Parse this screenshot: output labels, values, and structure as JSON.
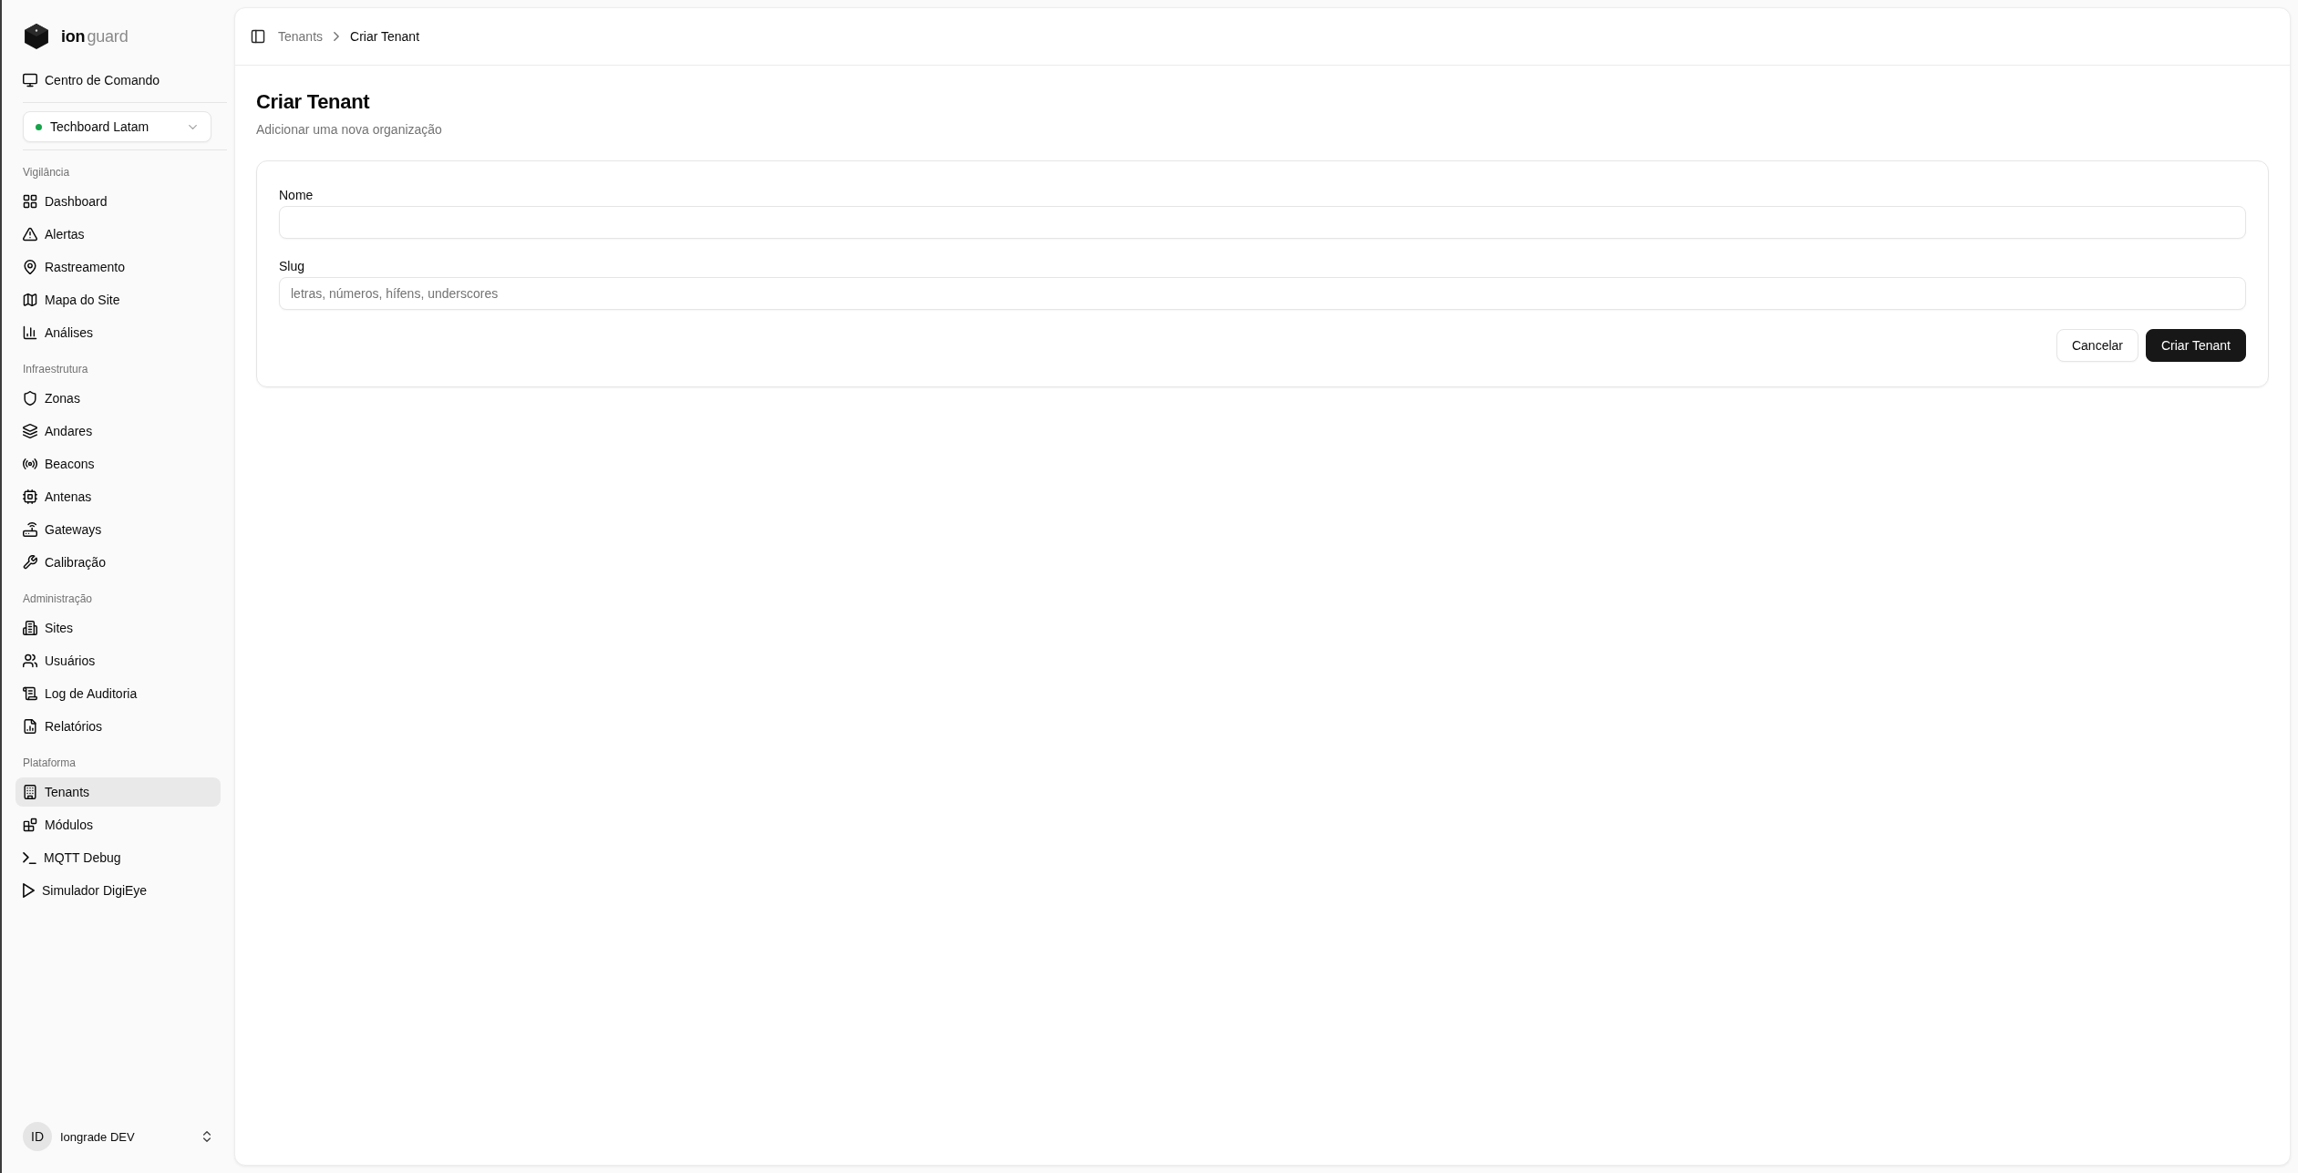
{
  "sidebar": {
    "brand": "**ion**guard",
    "command_center": {
      "label": "Centro de Comando"
    },
    "tenant_select": {
      "value": "Techboard Latam"
    },
    "sections": [
      {
        "title": "Vigilância",
        "items": [
          {
            "label": "Dashboard",
            "selected": false
          },
          {
            "label": "Alertas",
            "selected": false
          },
          {
            "label": "Rastreamento",
            "selected": false
          },
          {
            "label": "Mapa do Site",
            "selected": false
          },
          {
            "label": "Análises",
            "selected": false
          }
        ]
      },
      {
        "title": "Infraestrutura",
        "items": [
          {
            "label": "Zonas",
            "selected": false
          },
          {
            "label": "Andares",
            "selected": false
          },
          {
            "label": "Beacons",
            "selected": false
          },
          {
            "label": "Antenas",
            "selected": false
          },
          {
            "label": "Gateways",
            "selected": false
          },
          {
            "label": "Calibração",
            "selected": false
          }
        ]
      },
      {
        "title": "Administração",
        "items": [
          {
            "label": "Sites",
            "selected": false
          },
          {
            "label": "Usuários",
            "selected": false
          },
          {
            "label": "Log de Auditoria",
            "selected": false
          },
          {
            "label": "Relatórios",
            "selected": false
          }
        ]
      },
      {
        "title": "Plataforma",
        "items": [
          {
            "label": "Tenants",
            "selected": true
          },
          {
            "label": "Módulos",
            "selected": false
          },
          {
            "label": "MQTT Debug",
            "selected": false
          },
          {
            "label": "Simulador DigiEye",
            "selected": false
          }
        ]
      }
    ],
    "user": {
      "initials": "ID",
      "name": "Iongrade DEV"
    }
  },
  "header": {
    "breadcrumb": [
      {
        "label": "Tenants"
      },
      {
        "label": "Criar Tenant"
      }
    ]
  },
  "page": {
    "title": "Criar Tenant",
    "subtitle": "Adicionar uma nova organização"
  },
  "form": {
    "fields": [
      {
        "label": "Nome"
      },
      {
        "label": "Slug",
        "placeholder": "letras, números, hífens, underscores"
      }
    ],
    "buttons": [
      {
        "label": "Cancelar",
        "kind": "secondary"
      },
      {
        "label": "Criar Tenant",
        "kind": "primary"
      }
    ]
  }
}
